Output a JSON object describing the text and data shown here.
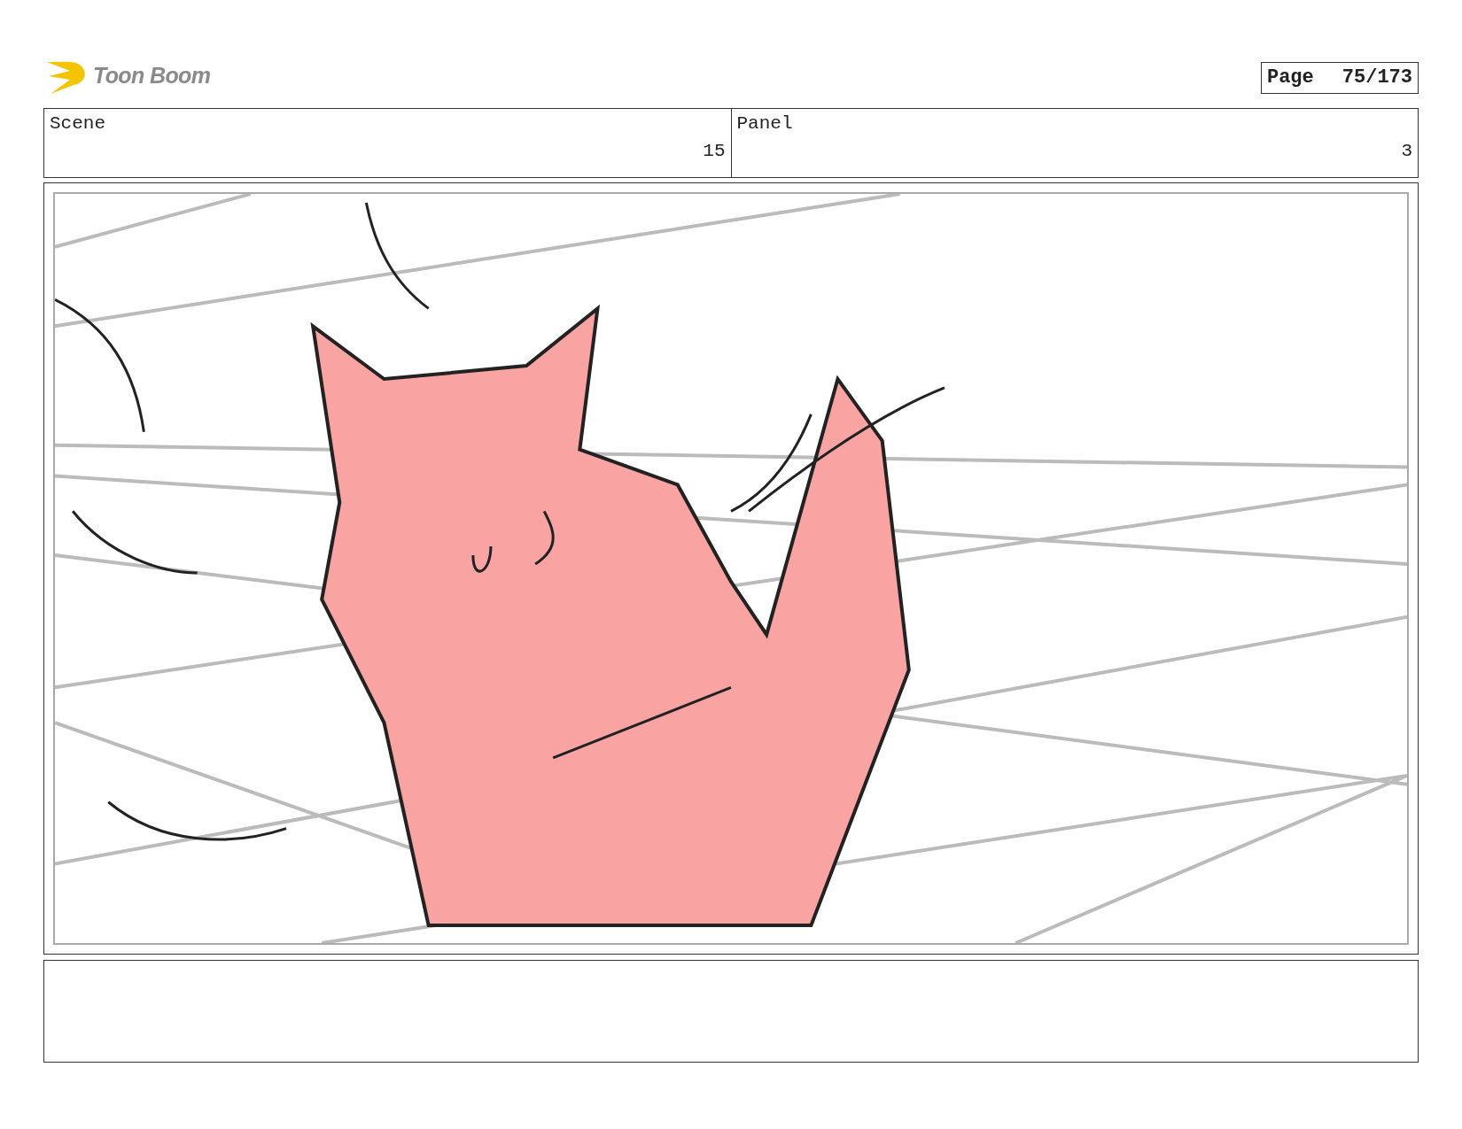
{
  "logo": {
    "text": "Toon Boom"
  },
  "page": {
    "label": "Page",
    "number": "75/173"
  },
  "header": {
    "scene": {
      "label": "Scene",
      "value": "15"
    },
    "panel": {
      "label": "Panel",
      "value": "3"
    }
  }
}
